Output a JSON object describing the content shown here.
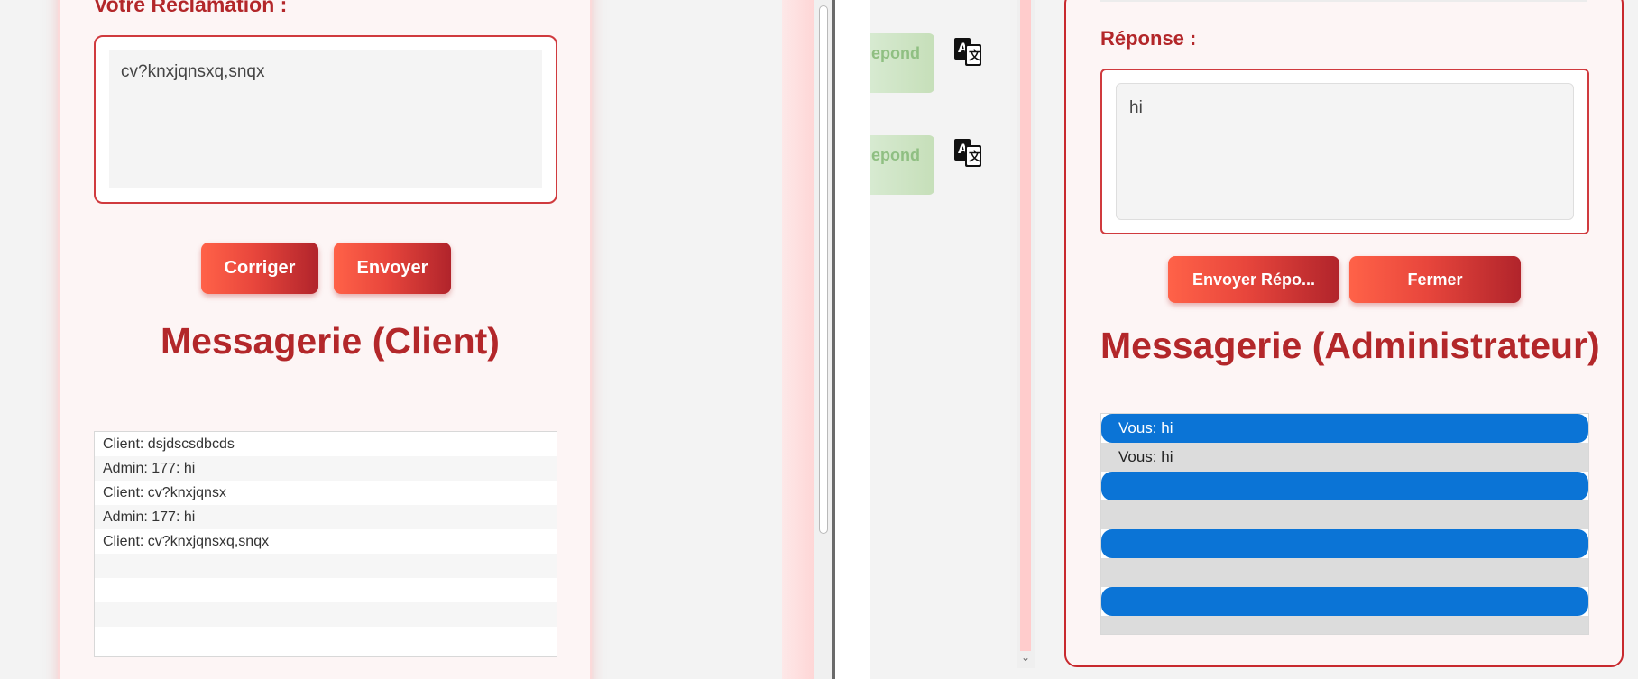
{
  "client": {
    "reclamation_label": "Votre Reclamation :",
    "reclamation_text": "cv?knxjqnsxq,snqx",
    "corriger_label": "Corriger",
    "envoyer_label": "Envoyer",
    "messagerie_title": "Messagerie (Client)",
    "messages": [
      "Client: dsjdscsdbcds",
      "Admin: 177: hi",
      "Client: cv?knxjqnsx",
      "Admin: 177: hi",
      "Client: cv?knxjqnsxq,snqx",
      "",
      "",
      "",
      ""
    ]
  },
  "admin": {
    "repond_label": "epond",
    "translate_icon": "translate-icon",
    "reponse_label": "Réponse :",
    "reponse_text": "hi",
    "envoyer_reponse_label": "Envoyer Répo...",
    "fermer_label": "Fermer",
    "messagerie_title": "Messagerie (Administrateur)",
    "messages": [
      "Vous: hi",
      "Vous: hi",
      "",
      "",
      "",
      "",
      "",
      ""
    ]
  },
  "colors": {
    "accent_red": "#b3272a",
    "button_gradient_start": "#ff6248",
    "button_gradient_end": "#b1242b",
    "admin_message_blue": "#0b74d6",
    "repond_green": "#c6dfb9"
  }
}
